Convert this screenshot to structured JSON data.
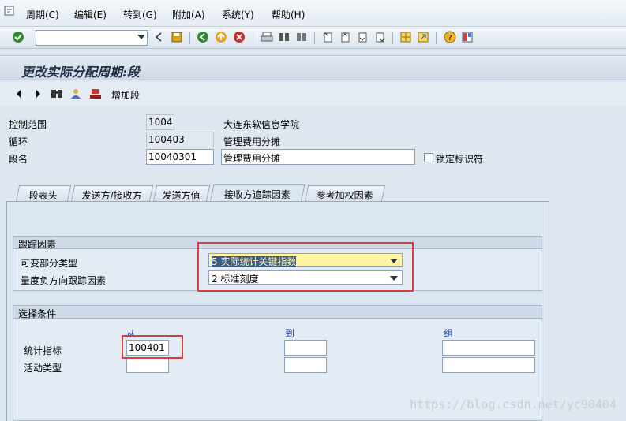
{
  "menu": {
    "items": [
      "周期(C)",
      "编辑(E)",
      "转到(G)",
      "附加(A)",
      "系统(Y)",
      "帮助(H)"
    ]
  },
  "toolbar": {
    "command_field_value": "",
    "icons": [
      "check-icon",
      "back-icon",
      "save-icon",
      "nav-back-icon",
      "exit-icon",
      "cancel-icon",
      "print-icon",
      "find-icon",
      "find-next-icon",
      "first-page-icon",
      "prev-page-icon",
      "next-page-icon",
      "last-page-icon",
      "new-session-icon",
      "shortcut-icon",
      "help-icon",
      "layout-icon"
    ]
  },
  "title": "更改实际分配周期:段",
  "app_toolbar": {
    "add_segment_label": "增加段"
  },
  "header": {
    "controlling_area_label": "控制范围",
    "controlling_area_value": "1004",
    "controlling_area_desc": "大连东软信息学院",
    "cycle_label": "循环",
    "cycle_value": "100403",
    "cycle_desc": "管理费用分摊",
    "segment_label": "段名",
    "segment_value": "10040301",
    "segment_desc": "管理费用分摊",
    "lock_label": "锁定标识符"
  },
  "tabs": [
    {
      "label": "段表头"
    },
    {
      "label": "发送方/接收方"
    },
    {
      "label": "发送方值"
    },
    {
      "label": "接收方追踪因素"
    },
    {
      "label": "参考加权因素"
    }
  ],
  "tracing": {
    "group_title": "跟踪因素",
    "variable_portion_label": "可变部分类型",
    "variable_portion_value": "5 实际统计关键指数",
    "measure_label": "量度负方向跟踪因素",
    "measure_value": "2 标准刻度"
  },
  "selection": {
    "group_title": "选择条件",
    "col_from": "从",
    "col_to": "到",
    "col_group": "组",
    "stat_key_label": "统计指标",
    "stat_key_from": "100401",
    "activity_label": "活动类型"
  },
  "watermark": "https://blog.csdn.net/yc90404",
  "colors": {
    "highlight_box": "#e03c3c",
    "selected_dropdown_bg": "#fff5a3"
  }
}
